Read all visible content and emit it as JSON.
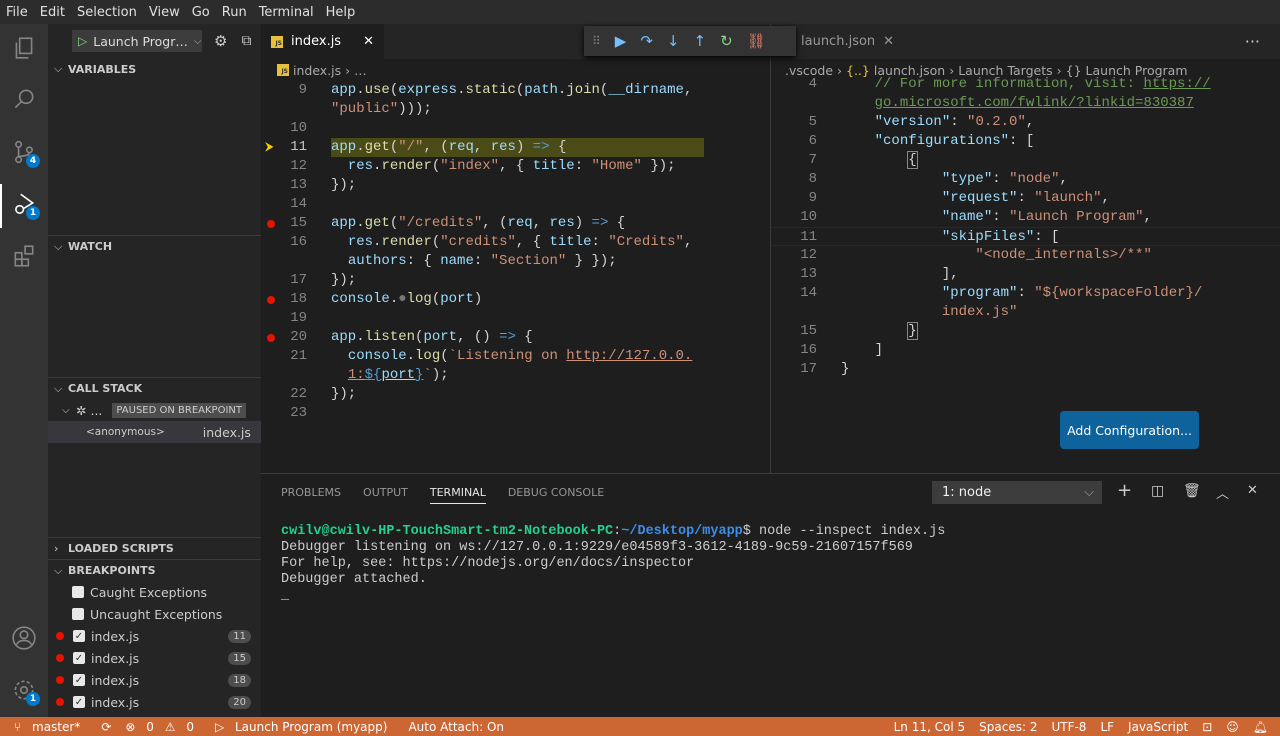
{
  "menu": [
    "File",
    "Edit",
    "Selection",
    "View",
    "Go",
    "Run",
    "Terminal",
    "Help"
  ],
  "activity": {
    "scm_badge": "4",
    "debug_badge": "1",
    "settings_badge": "1"
  },
  "debug_config": "Launch Progr…",
  "sidebar": {
    "variables": "VARIABLES",
    "watch": "WATCH",
    "call_stack": "CALL STACK",
    "thread_label": "...",
    "paused_badge": "PAUSED ON BREAKPOINT",
    "frame_name": "<anonymous>",
    "frame_file": "index.js",
    "loaded_scripts": "LOADED SCRIPTS",
    "breakpoints": "BREAKPOINTS",
    "caught": "Caught Exceptions",
    "uncaught": "Uncaught Exceptions",
    "bps": [
      {
        "file": "index.js",
        "line": "11"
      },
      {
        "file": "index.js",
        "line": "15"
      },
      {
        "file": "index.js",
        "line": "18"
      },
      {
        "file": "index.js",
        "line": "20"
      }
    ]
  },
  "left_editor": {
    "tab": "index.js",
    "crumb_file": "index.js",
    "crumb_more": "…"
  },
  "right_editor": {
    "tab": "launch.json",
    "crumb": [
      ".vscode",
      "launch.json",
      "Launch Targets",
      "Launch Program"
    ],
    "add_config": "Add Configuration..."
  },
  "panel": {
    "tabs": [
      "PROBLEMS",
      "OUTPUT",
      "TERMINAL",
      "DEBUG CONSOLE"
    ],
    "terminal_select": "1: node",
    "prompt_user": "cwilv@cwilv-HP-TouchSmart-tm2-Notebook-PC",
    "prompt_path": "~/Desktop/myapp",
    "cmd": "$ node --inspect index.js",
    "lines": [
      "Debugger listening on ws://127.0.0.1:9229/e04589f3-3612-4189-9c59-21607157f569",
      "For help, see: https://nodejs.org/en/docs/inspector",
      "Debugger attached.",
      "_"
    ]
  },
  "status": {
    "branch": "master*",
    "errors": "0",
    "warnings": "0",
    "launch": "Launch Program (myapp)",
    "auto_attach": "Auto Attach: On",
    "position": "Ln 11, Col 5",
    "spaces": "Spaces: 2",
    "encoding": "UTF-8",
    "eol": "LF",
    "language": "JavaScript"
  }
}
